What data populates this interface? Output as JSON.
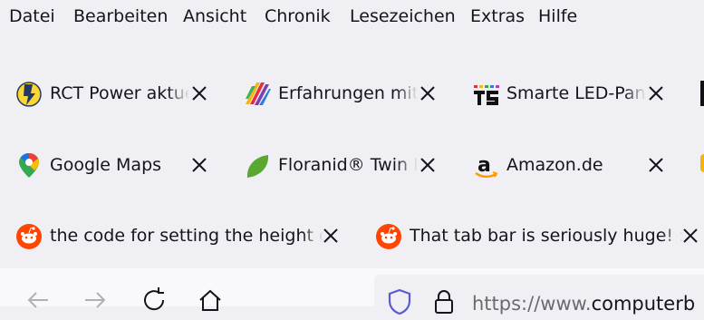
{
  "menubar": {
    "items": [
      {
        "label": "Datei"
      },
      {
        "label": "Bearbeiten"
      },
      {
        "label": "Ansicht"
      },
      {
        "label": "Chronik"
      },
      {
        "label": "Lesezeichen"
      },
      {
        "label": "Extras"
      },
      {
        "label": "Hilfe"
      }
    ]
  },
  "tabs": {
    "row1": [
      {
        "title": "RCT Power aktue",
        "icon": "rct-power-favicon"
      },
      {
        "title": "Erfahrungen mit",
        "icon": "erfahrungen-favicon"
      },
      {
        "title": "Smarte LED-Pane",
        "icon": "t5-favicon"
      }
    ],
    "row2": [
      {
        "title": "Google Maps",
        "icon": "map-pin-icon"
      },
      {
        "title": "Floranid® Twin P",
        "icon": "leaf-icon"
      },
      {
        "title": "Amazon.de",
        "icon": "amazon-icon"
      }
    ],
    "row3": [
      {
        "title": "the code for setting the height o",
        "icon": "reddit-icon"
      },
      {
        "title": "That tab bar is seriously huge! : f",
        "icon": "reddit-icon"
      }
    ]
  },
  "urlbar": {
    "url_prefix": "https://www.",
    "url_domain": "computerb"
  },
  "colors": {
    "background": "#f0f0f4",
    "navbar": "#f9f9fb",
    "reddit": "#ff4500",
    "google_maps_green": "#34a853",
    "floranid_green": "#5aa832",
    "amazon_orange": "#ff9900"
  }
}
